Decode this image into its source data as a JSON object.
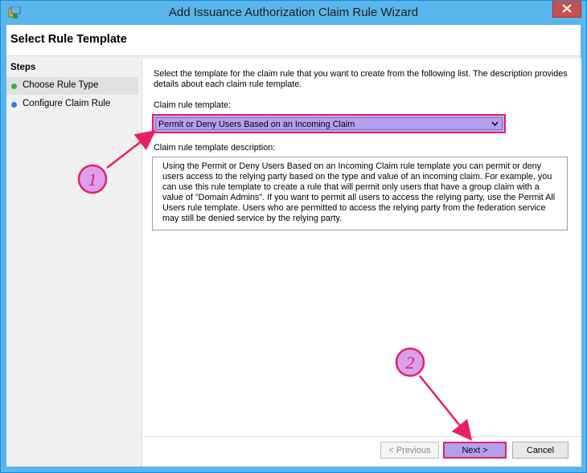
{
  "window": {
    "title": "Add Issuance Authorization Claim Rule Wizard"
  },
  "header": {
    "title": "Select Rule Template"
  },
  "steps": {
    "title": "Steps",
    "items": [
      {
        "label": "Choose Rule Type",
        "status_color": "#3cb14a"
      },
      {
        "label": "Configure Claim Rule",
        "status_color": "#2f7fd8"
      }
    ]
  },
  "main": {
    "intro": "Select the template for the claim rule that you want to create from the following list. The description provides details about each claim rule template.",
    "template_label": "Claim rule template:",
    "template_value": "Permit or Deny Users Based on an Incoming Claim",
    "description_label": "Claim rule template description:",
    "description": "Using the Permit or Deny Users Based on an Incoming Claim rule template you can permit or deny users access to the relying party based on the type and value of an incoming claim.  For example, you can use this rule template to create a rule that will permit only users that have a group claim with a value of \"Domain Admins\".  If you want to permit all users to access the relying party, use the Permit All Users rule template.  Users who are permitted to access the relying party from the federation service may still be denied service by the relying party."
  },
  "buttons": {
    "previous": "< Previous",
    "next": "Next >",
    "cancel": "Cancel"
  },
  "annotations": {
    "marker1": "1",
    "marker2": "2",
    "highlight_color": "#e91e63"
  }
}
